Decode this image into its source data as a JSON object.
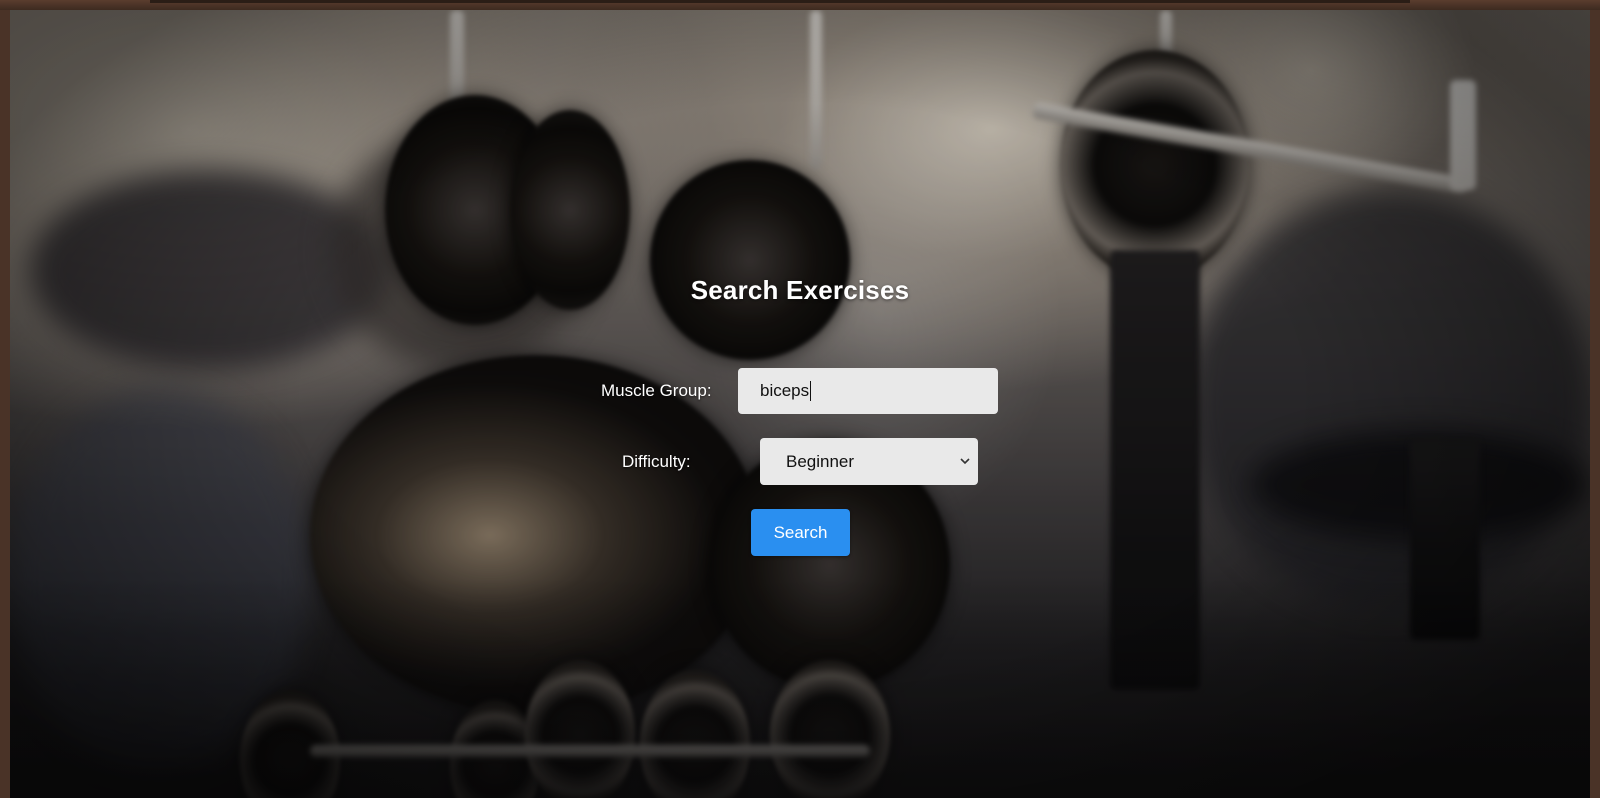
{
  "page": {
    "title": "Search Exercises"
  },
  "form": {
    "muscle_group_label": "Muscle Group:",
    "muscle_group_value": "biceps",
    "difficulty_label": "Difficulty:",
    "difficulty_selected": "Beginner",
    "search_button_label": "Search"
  },
  "icons": {
    "select_arrow": "chevron-down-icon"
  },
  "colors": {
    "accent": "#2a8ff0",
    "input_background": "#e9e9e9",
    "title_text": "#ffffff"
  }
}
